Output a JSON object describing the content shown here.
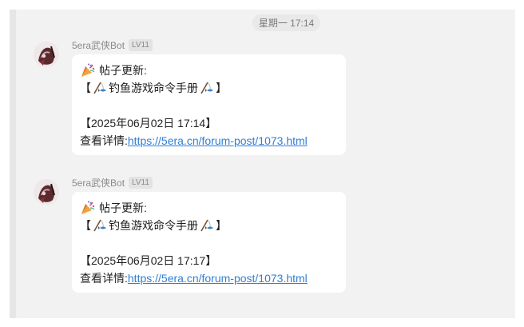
{
  "timestamp": "星期一 17:14",
  "messages": [
    {
      "sender": "5era武侠Bot",
      "level": "LV11",
      "avatar_icon": "character-avatar",
      "party_icon": "party-popper-icon",
      "title": "帖子更新:",
      "post_prefix": "【",
      "post_title": "钓鱼游戏命令手册",
      "post_suffix": "】",
      "date_line": "【2025年06月02日 17:14】",
      "detail_label": "查看详情:",
      "link": "https://5era.cn/forum-post/1073.html"
    },
    {
      "sender": "5era武侠Bot",
      "level": "LV11",
      "avatar_icon": "character-avatar",
      "party_icon": "party-popper-icon",
      "title": "帖子更新:",
      "post_prefix": "【",
      "post_title": "钓鱼游戏命令手册",
      "post_suffix": "】",
      "date_line": "【2025年06月02日 17:17】",
      "detail_label": "查看详情:",
      "link": "https://5era.cn/forum-post/1073.html"
    }
  ]
}
